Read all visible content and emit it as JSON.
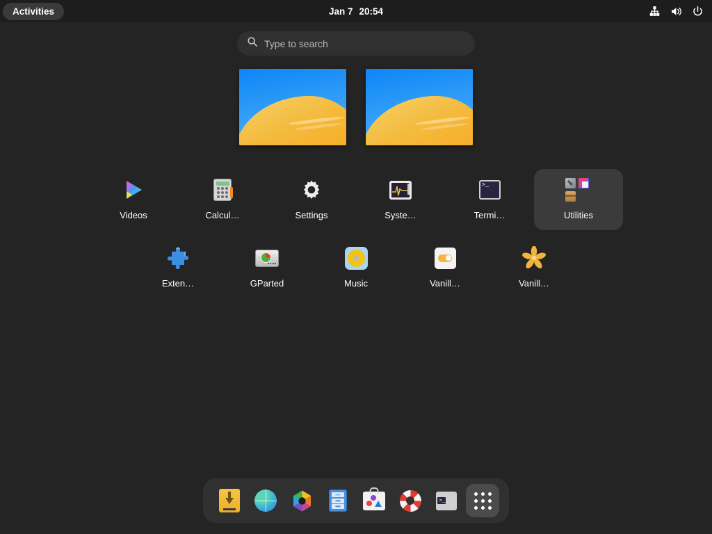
{
  "topbar": {
    "activities_label": "Activities",
    "clock_date": "Jan 7",
    "clock_time": "20:54",
    "status_icons": [
      "network-wired-icon",
      "volume-icon",
      "power-icon"
    ]
  },
  "search": {
    "placeholder": "Type to search",
    "value": "",
    "icon": "search-icon"
  },
  "workspaces": {
    "count": 2,
    "items": [
      {
        "name": "workspace-1"
      },
      {
        "name": "workspace-2"
      }
    ]
  },
  "app_grid": {
    "rows": [
      [
        {
          "label": "Videos",
          "icon": "videos-icon",
          "type": "app"
        },
        {
          "label": "Calcul…",
          "icon": "calculator-icon",
          "type": "app"
        },
        {
          "label": "Settings",
          "icon": "settings-gear-icon",
          "type": "app"
        },
        {
          "label": "Syste…",
          "icon": "system-monitor-icon",
          "type": "app"
        },
        {
          "label": "Termi…",
          "icon": "terminal-icon",
          "type": "app"
        },
        {
          "label": "Utilities",
          "icon": "folder-icon",
          "type": "folder"
        }
      ],
      [
        {
          "label": "Exten…",
          "icon": "extensions-puzzle-icon",
          "type": "app"
        },
        {
          "label": "GParted",
          "icon": "gparted-disk-icon",
          "type": "app"
        },
        {
          "label": "Music",
          "icon": "music-icon",
          "type": "app"
        },
        {
          "label": "Vanill…",
          "icon": "vanilla-toggle-icon",
          "type": "app"
        },
        {
          "label": "Vanill…",
          "icon": "vanilla-star-icon",
          "type": "app"
        }
      ]
    ]
  },
  "dash": {
    "items": [
      {
        "name": "install-media-icon"
      },
      {
        "name": "web-browser-icon"
      },
      {
        "name": "photos-icon"
      },
      {
        "name": "files-icon"
      },
      {
        "name": "software-icon"
      },
      {
        "name": "help-icon"
      },
      {
        "name": "terminal-icon"
      },
      {
        "name": "show-apps-grid-icon"
      }
    ],
    "show_apps_active": true
  },
  "colors": {
    "background": "#242424",
    "topbar": "#1d1d1d",
    "panel": "#303030",
    "highlight": "#3b3b3b",
    "accent_orange": "#f2b63c",
    "accent_blue": "#4a90e2"
  }
}
